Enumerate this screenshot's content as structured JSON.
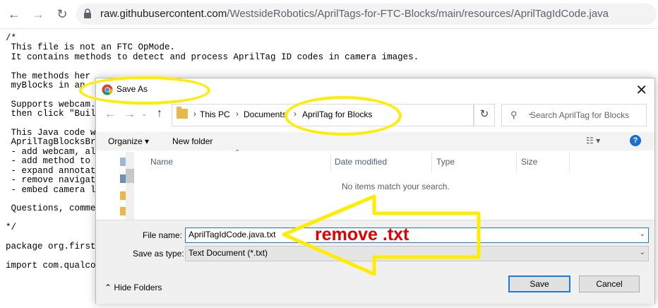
{
  "browser": {
    "url_host": "raw.githubusercontent.com",
    "url_path": "/WestsideRobotics/AprilTags-for-FTC-Blocks/main/resources/AprilTagIdCode.java"
  },
  "source_text": "/*\n This file is not an FTC OpMode.\n It contains methods to detect and process AprilTag ID codes in camera images.\n\n The methods her\n myBlocks in an\n\n Supports webcam.\n then click \"Build\n\n This Java code wa\n AprilTagBlocksBri\n - add webcam, all\n - add method to c\n - expand annotati\n - remove navigati\n - embed camera le\n\n Questions, commen\n\n*/\n\npackage org.firsti\n\nimport com.qualcom",
  "dialog": {
    "title": "Save As",
    "breadcrumbs": [
      "This PC",
      "Documents",
      "AprilTag for Blocks"
    ],
    "search_placeholder": "Search AprilTag for Blocks",
    "organize_label": "Organize",
    "new_folder_label": "New folder",
    "columns": [
      "Name",
      "Date modified",
      "Type",
      "Size"
    ],
    "empty_message": "No items match your search.",
    "file_name_label": "File name:",
    "file_name_value": "AprilTagIdCode.java.txt",
    "save_as_type_label": "Save as type:",
    "save_as_type_value": "Text Document (*.txt)",
    "hide_folders_label": "Hide Folders",
    "save_label": "Save",
    "cancel_label": "Cancel"
  },
  "annotation": {
    "text": "remove .txt",
    "highlight_color": "#ffed00",
    "text_color": "#e00000"
  }
}
